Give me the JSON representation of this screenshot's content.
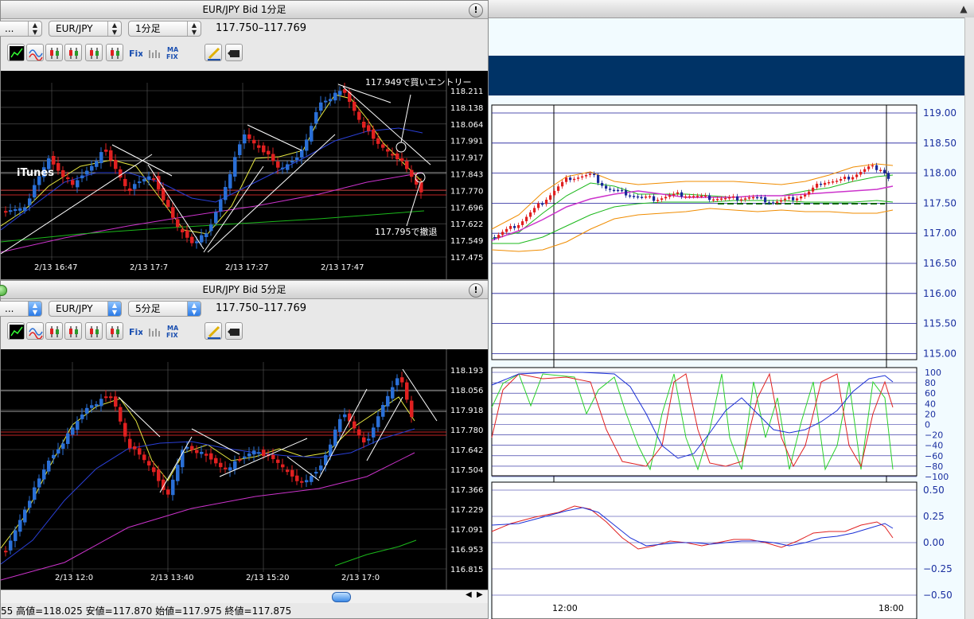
{
  "window1": {
    "title": "EUR/JPY Bid 1分足",
    "selects": {
      "first": "...",
      "pair": "EUR/JPY",
      "timeframe": "1分足"
    },
    "price_range": "117.750–117.769",
    "annotations": {
      "entry": "117.949で買いエントリー",
      "exit": "117.795で撤退",
      "itunes": "iTunes"
    },
    "y_ticks": [
      "118.211",
      "118.138",
      "118.064",
      "117.991",
      "117.917",
      "117.843",
      "117.770",
      "117.696",
      "117.622",
      "117.549",
      "117.475"
    ],
    "x_ticks": [
      "2/13 16:47",
      "2/13 17:7",
      "2/13 17:27",
      "2/13 17:47"
    ]
  },
  "window2": {
    "title": "EUR/JPY Bid 5分足",
    "selects": {
      "first": "...",
      "pair": "EUR/JPY",
      "timeframe": "5分足"
    },
    "price_range": "117.750–117.769",
    "y_ticks": [
      "118.193",
      "118.056",
      "117.918",
      "117.780",
      "117.642",
      "117.504",
      "117.366",
      "117.229",
      "117.091",
      "116.953",
      "116.815"
    ],
    "x_ticks": [
      "2/13 12:0",
      "2/13 13:40",
      "2/13 15:20",
      "2/13 17:0"
    ]
  },
  "toolbar_labels": {
    "fix": "Fix",
    "ma": "MA",
    "ma_fix": "FIX"
  },
  "status": {
    "text": "55  高値=118.025  安値=117.870  始値=117.975  終値=117.875"
  },
  "bg_chart": {
    "price_ticks": [
      "119.00",
      "118.50",
      "118.00",
      "117.50",
      "117.00",
      "116.50",
      "116.00",
      "115.50",
      "115.00"
    ],
    "osc_ticks": [
      "100",
      "80",
      "60",
      "40",
      "20",
      "0",
      "−20",
      "−40",
      "−60",
      "−80",
      "−100"
    ],
    "macd_ticks": [
      "0.50",
      "0.25",
      "0.00",
      "−0.25",
      "−0.50"
    ],
    "x_ticks": [
      "12:00",
      "18:00"
    ]
  },
  "colors": {
    "chart_bg": "#000000",
    "bull": "#2a6fd6",
    "bear": "#e02020",
    "header_band": "#003366"
  }
}
